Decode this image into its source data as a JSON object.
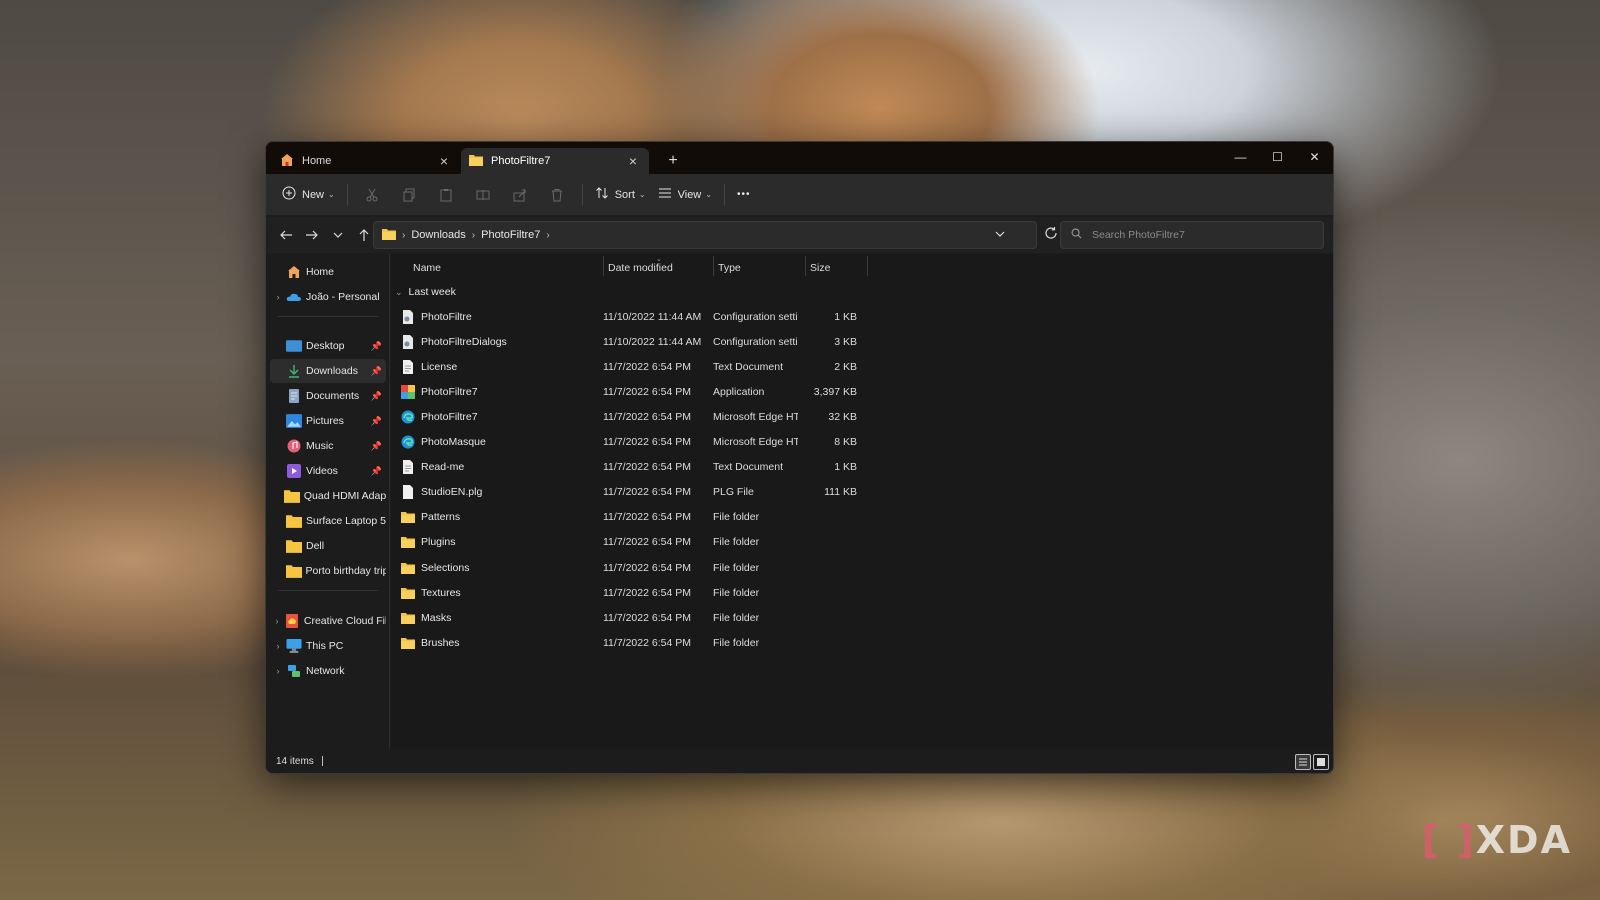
{
  "tabs": [
    {
      "label": "Home",
      "icon": "home-icon"
    },
    {
      "label": "PhotoFiltre7",
      "icon": "folder-icon"
    }
  ],
  "toolbar": {
    "new_label": "New",
    "sort_label": "Sort",
    "view_label": "View",
    "more_label": "•••"
  },
  "address": {
    "crumbs": [
      "Downloads",
      "PhotoFiltre7"
    ]
  },
  "search": {
    "placeholder": "Search PhotoFiltre7"
  },
  "sidebar": {
    "items": [
      {
        "label": "Home",
        "icon": "home-icon"
      },
      {
        "label": "João - Personal",
        "icon": "onedrive-icon"
      },
      {
        "label": "Desktop",
        "icon": "desktop-icon"
      },
      {
        "label": "Downloads",
        "icon": "download-icon"
      },
      {
        "label": "Documents",
        "icon": "document-icon"
      },
      {
        "label": "Pictures",
        "icon": "pictures-icon"
      },
      {
        "label": "Music",
        "icon": "music-icon"
      },
      {
        "label": "Videos",
        "icon": "videos-icon"
      },
      {
        "label": "Quad HDMI Adapter",
        "icon": "folder-icon"
      },
      {
        "label": "Surface Laptop 5",
        "icon": "folder-icon"
      },
      {
        "label": "Dell",
        "icon": "folder-icon"
      },
      {
        "label": "Porto birthday trip",
        "icon": "folder-icon"
      },
      {
        "label": "Creative Cloud Files",
        "icon": "creative-cloud-icon"
      },
      {
        "label": "This PC",
        "icon": "pc-icon"
      },
      {
        "label": "Network",
        "icon": "network-icon"
      }
    ]
  },
  "columns": {
    "name": "Name",
    "date": "Date modified",
    "type": "Type",
    "size": "Size"
  },
  "group": {
    "label": "Last week"
  },
  "files": [
    {
      "name": "PhotoFiltre",
      "date": "11/10/2022 11:44 AM",
      "type": "Configuration setti...",
      "size": "1 KB",
      "icon": "config-icon"
    },
    {
      "name": "PhotoFiltreDialogs",
      "date": "11/10/2022 11:44 AM",
      "type": "Configuration setti...",
      "size": "3 KB",
      "icon": "config-icon"
    },
    {
      "name": "License",
      "date": "11/7/2022 6:54 PM",
      "type": "Text Document",
      "size": "2 KB",
      "icon": "text-file-icon"
    },
    {
      "name": "PhotoFiltre7",
      "date": "11/7/2022 6:54 PM",
      "type": "Application",
      "size": "3,397 KB",
      "icon": "app-icon"
    },
    {
      "name": "PhotoFiltre7",
      "date": "11/7/2022 6:54 PM",
      "type": "Microsoft Edge HT...",
      "size": "32 KB",
      "icon": "edge-icon"
    },
    {
      "name": "PhotoMasque",
      "date": "11/7/2022 6:54 PM",
      "type": "Microsoft Edge HT...",
      "size": "8 KB",
      "icon": "edge-icon"
    },
    {
      "name": "Read-me",
      "date": "11/7/2022 6:54 PM",
      "type": "Text Document",
      "size": "1 KB",
      "icon": "text-file-icon"
    },
    {
      "name": "StudioEN.plg",
      "date": "11/7/2022 6:54 PM",
      "type": "PLG File",
      "size": "111 KB",
      "icon": "file-icon"
    },
    {
      "name": "Patterns",
      "date": "11/7/2022 6:54 PM",
      "type": "File folder",
      "size": "",
      "icon": "folder-icon"
    },
    {
      "name": "Plugins",
      "date": "11/7/2022 6:54 PM",
      "type": "File folder",
      "size": "",
      "icon": "folder-icon"
    },
    {
      "name": "Selections",
      "date": "11/7/2022 6:54 PM",
      "type": "File folder",
      "size": "",
      "icon": "folder-icon"
    },
    {
      "name": "Textures",
      "date": "11/7/2022 6:54 PM",
      "type": "File folder",
      "size": "",
      "icon": "folder-icon"
    },
    {
      "name": "Masks",
      "date": "11/7/2022 6:54 PM",
      "type": "File folder",
      "size": "",
      "icon": "folder-icon"
    },
    {
      "name": "Brushes",
      "date": "11/7/2022 6:54 PM",
      "type": "File folder",
      "size": "",
      "icon": "folder-icon"
    }
  ],
  "status": {
    "count": "14 items"
  },
  "watermark": {
    "text": "XDA"
  },
  "colors": {
    "accent": "#4cc2ff",
    "folder": "#f5c542",
    "window_bg": "#1c1c1c"
  }
}
